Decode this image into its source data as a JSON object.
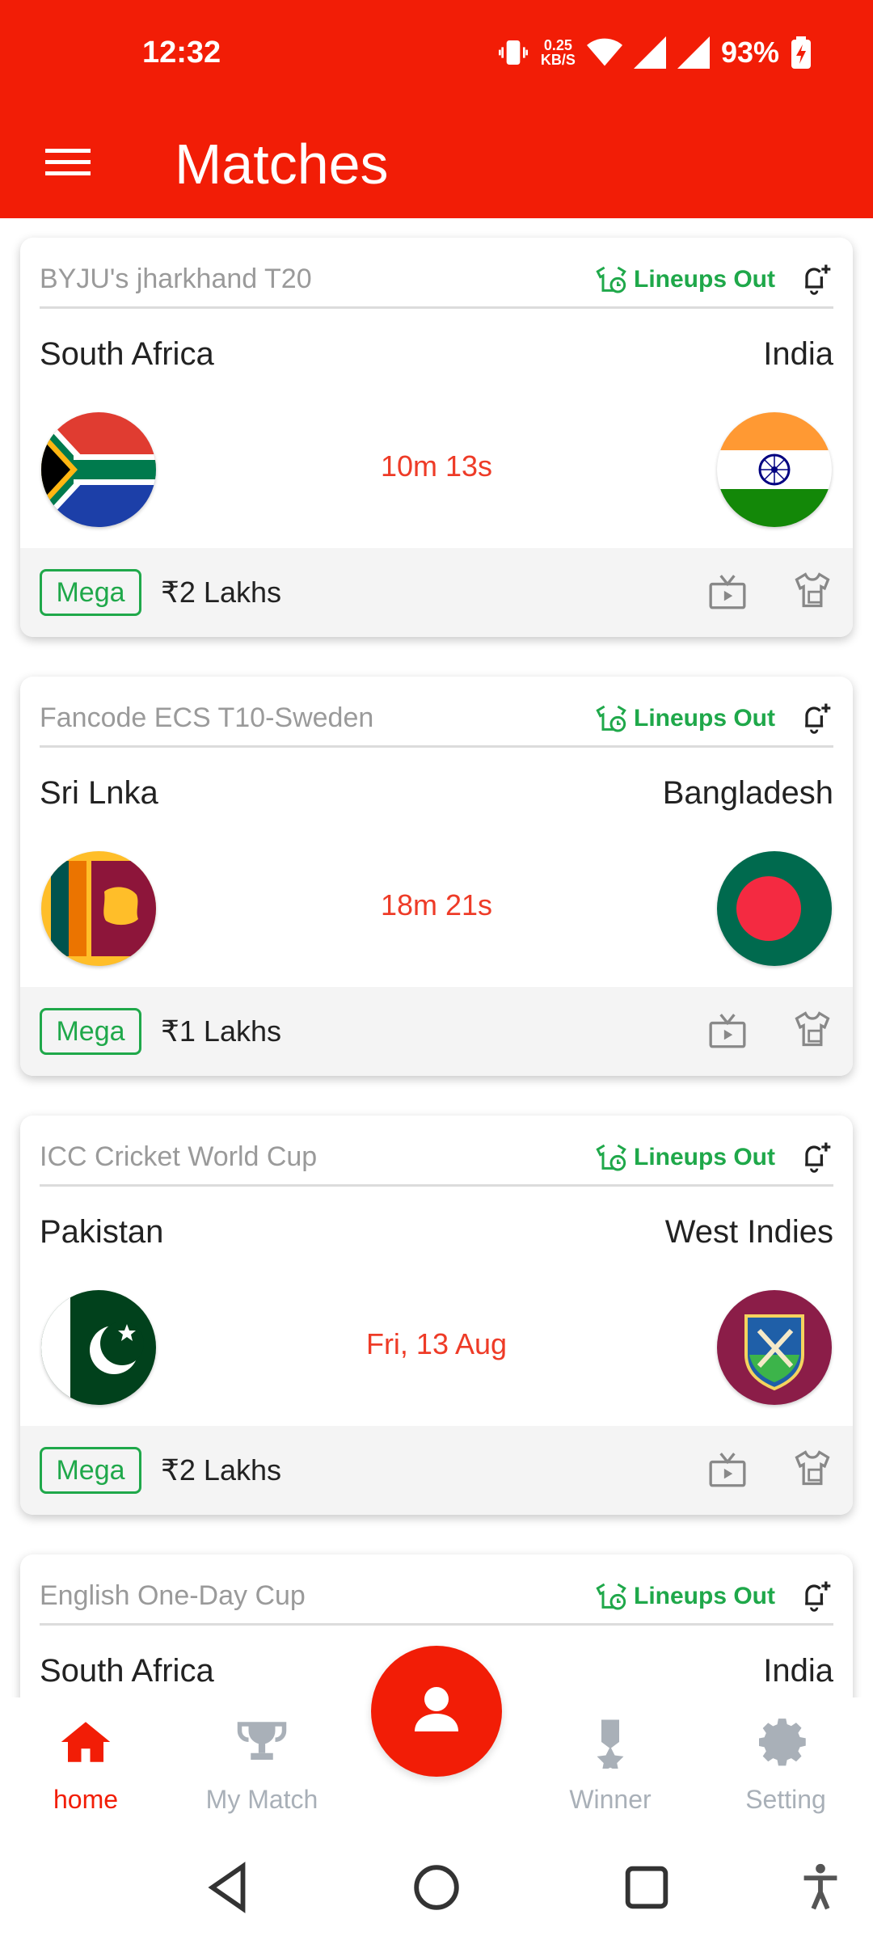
{
  "status_bar": {
    "time": "12:32",
    "speed_value": "0.25",
    "speed_unit": "KB/S",
    "battery": "93%"
  },
  "app_bar": {
    "title": "Matches"
  },
  "colors": {
    "brand": "#f21d06",
    "lineups_green": "#1fa84a",
    "timer_red": "#ee3b27"
  },
  "matches": [
    {
      "league": "BYJU's jharkhand T20",
      "lineups": "Lineups Out",
      "team_left": "South Africa",
      "team_right": "India",
      "flag_left": "south-africa-flag",
      "flag_right": "india-flag",
      "time": "10m 13s",
      "badge": "Mega",
      "prize": "₹2 Lakhs"
    },
    {
      "league": "Fancode ECS T10-Sweden",
      "lineups": "Lineups Out",
      "team_left": "Sri Lnka",
      "team_right": "Bangladesh",
      "flag_left": "sri-lanka-flag",
      "flag_right": "bangladesh-flag",
      "time": "18m 21s",
      "badge": "Mega",
      "prize": "₹1 Lakhs"
    },
    {
      "league": "ICC Cricket World Cup",
      "lineups": "Lineups Out",
      "team_left": "Pakistan",
      "team_right": "West Indies",
      "flag_left": "pakistan-flag",
      "flag_right": "west-indies-flag",
      "time": "Fri, 13 Aug",
      "badge": "Mega",
      "prize": "₹2 Lakhs"
    },
    {
      "league": "English One-Day Cup",
      "lineups": "Lineups Out",
      "team_left": "South Africa",
      "team_right": "India"
    }
  ],
  "bottom_nav": {
    "home": "home",
    "my_match": "My Match",
    "winner": "Winner",
    "setting": "Setting"
  }
}
